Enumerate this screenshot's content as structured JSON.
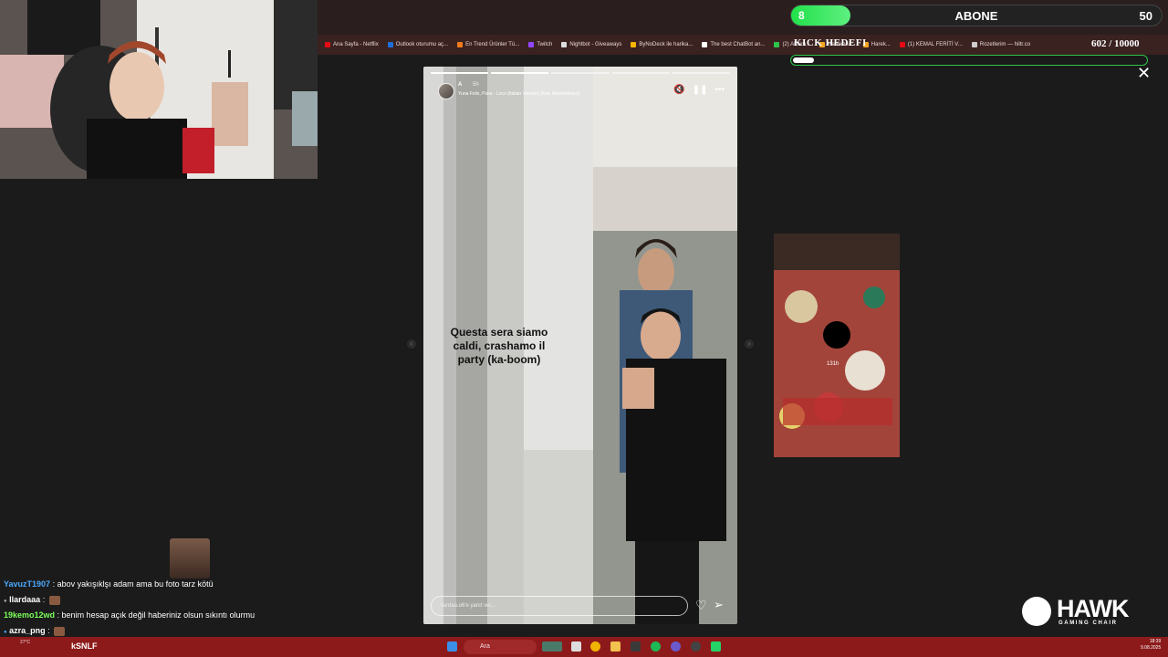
{
  "overlay": {
    "sub_count": "8",
    "sub_label": "ABONE",
    "sub_target": "50",
    "sub_progress_fraction": 0.16,
    "kick_title": "KICK HEDEFI",
    "kick_count": "602 / 10000",
    "kick_progress_fraction": 0.06
  },
  "bookmarks": [
    {
      "label": "Ana Sayfa - Netflix",
      "color": "#e50914"
    },
    {
      "label": "Outlook oturumu aç...",
      "color": "#1e6fd9"
    },
    {
      "label": "En Trend Ürünler Tü...",
      "color": "#f27a1a"
    },
    {
      "label": "Twitch",
      "color": "#9146ff"
    },
    {
      "label": "Nightbot - Giveaways",
      "color": "#dddddd"
    },
    {
      "label": "ByNoDeck ile harika...",
      "color": "#f5b400"
    },
    {
      "label": "The best ChatBot an...",
      "color": "#ffffff"
    },
    {
      "label": "(2) Albüm...",
      "color": "#2ec44a"
    },
    {
      "label": "Hareketli...",
      "color": "#f5a623"
    },
    {
      "label": "Harek...",
      "color": "#f5a623"
    },
    {
      "label": "(1) KEMAL FERİTİ V...",
      "color": "#e50914"
    },
    {
      "label": "Rozetlerim — hiltr.co",
      "color": "#cccccc"
    }
  ],
  "story": {
    "username": "A",
    "time": "5h",
    "music": "Yuna Felix, Poke - Loco (Italian Version) (feat. Mambolosco)",
    "caption": "Questa sera siamo caldi, crashamo il party (ka-boom)",
    "reply_placeholder": "llardaa.o6'e yanıt ver...",
    "mute_icon": "mute-icon",
    "pause_icon": "pause-icon"
  },
  "next_story": {
    "time": "131h"
  },
  "chat": [
    {
      "user": "YavuzT1907",
      "user_color": "#4aa8ff",
      "message": ": abov yakışıklşı adam ama bu foto tarz kötü",
      "emote": false
    },
    {
      "user": "llardaaa",
      "user_color": "#ffffff",
      "message": ":",
      "emote": true
    },
    {
      "user": "19kemo12wd",
      "user_color": "#7bff5a",
      "message": ": benim hesap açık değil haberiniz olsun sıkıntı olurmu",
      "emote": false
    },
    {
      "user": "azra_png",
      "user_color": "#ffffff",
      "message": ":",
      "emote": true
    }
  ],
  "taskbar": {
    "search_placeholder": "Ara",
    "chat_overlay_user": "kSNLF",
    "weather": "27°C",
    "time": "18:39",
    "date": "9.08.2025"
  },
  "sponsor": {
    "name": "HAWK",
    "tagline": "GAMING CHAIR"
  }
}
